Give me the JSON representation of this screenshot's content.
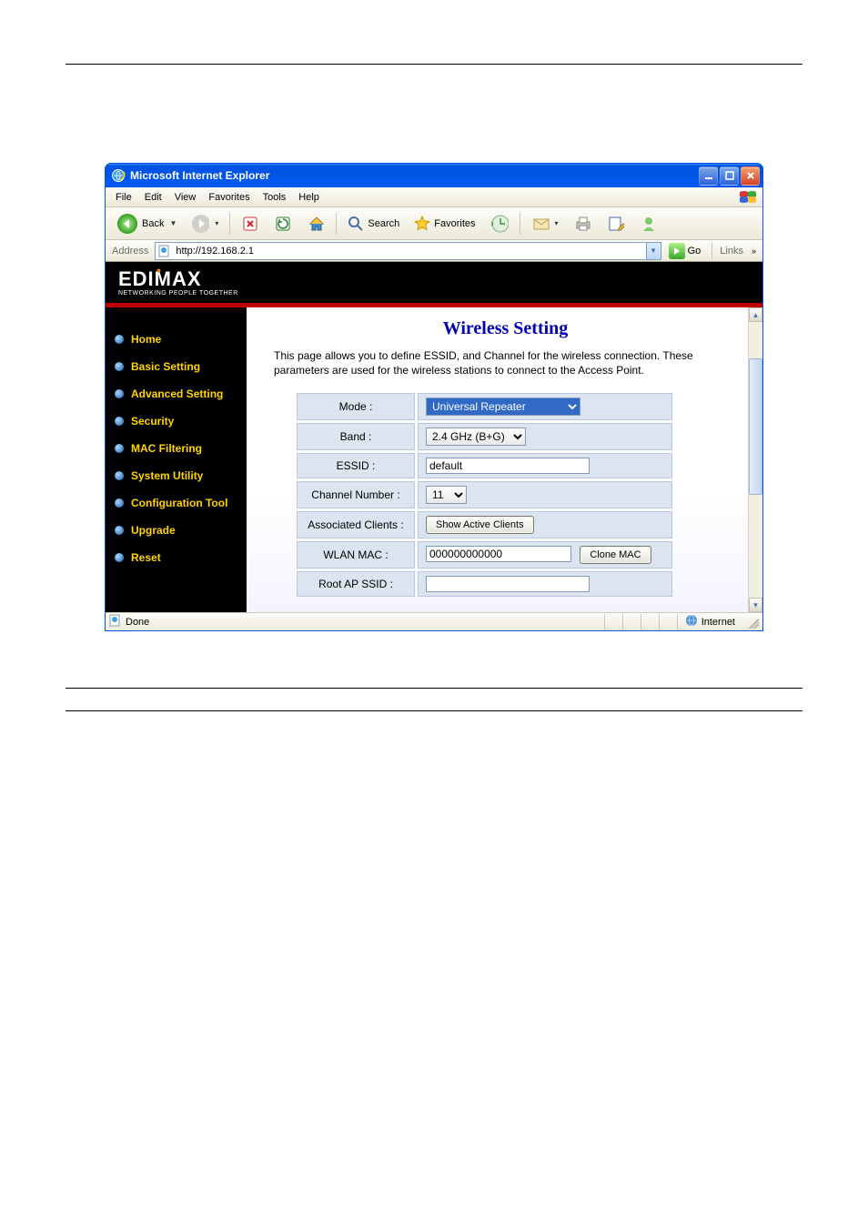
{
  "window": {
    "title": "Microsoft Internet Explorer"
  },
  "menu": {
    "items": [
      "File",
      "Edit",
      "View",
      "Favorites",
      "Tools",
      "Help"
    ]
  },
  "toolbar": {
    "back": "Back",
    "search": "Search",
    "favorites": "Favorites"
  },
  "address": {
    "label": "Address",
    "url": "http://192.168.2.1",
    "go": "Go",
    "links": "Links"
  },
  "brand": {
    "name": "EDIMAX",
    "tagline": "NETWORKING PEOPLE TOGETHER"
  },
  "sidebar": {
    "items": [
      {
        "label": "Home"
      },
      {
        "label": "Basic Setting"
      },
      {
        "label": "Advanced Setting"
      },
      {
        "label": "Security"
      },
      {
        "label": "MAC Filtering"
      },
      {
        "label": "System Utility"
      },
      {
        "label": "Configuration Tool"
      },
      {
        "label": "Upgrade"
      },
      {
        "label": "Reset"
      }
    ]
  },
  "page": {
    "title": "Wireless Setting",
    "desc": "This page allows you to define ESSID, and Channel for the wireless connection. These parameters are used for the wireless stations to connect to the Access Point."
  },
  "form": {
    "mode": {
      "label": "Mode :",
      "value": "Universal Repeater"
    },
    "band": {
      "label": "Band :",
      "value": "2.4 GHz (B+G)"
    },
    "essid": {
      "label": "ESSID :",
      "value": "default"
    },
    "channel": {
      "label": "Channel Number :",
      "value": "11"
    },
    "clients": {
      "label": "Associated Clients :",
      "button": "Show Active Clients"
    },
    "wlanmac": {
      "label": "WLAN MAC :",
      "value": "000000000000",
      "button": "Clone MAC"
    },
    "rootssid": {
      "label": "Root AP SSID :",
      "value": ""
    }
  },
  "status": {
    "left": "Done",
    "zone": "Internet"
  }
}
